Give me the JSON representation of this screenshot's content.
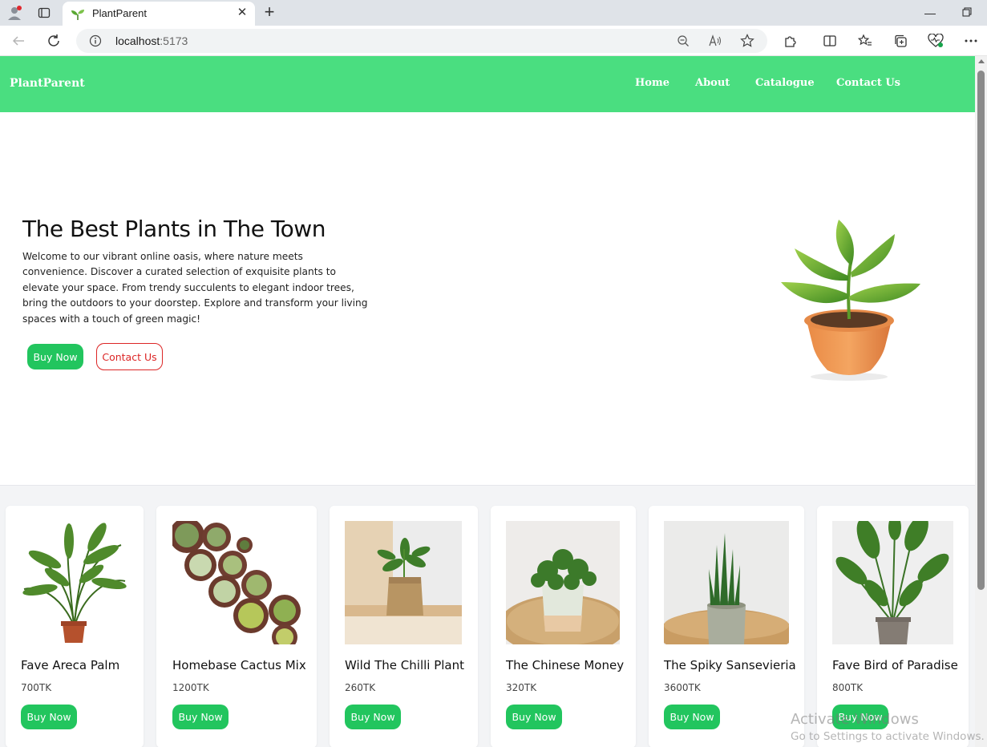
{
  "browser": {
    "tab_title": "PlantParent",
    "url_host": "localhost",
    "url_port": ":5173",
    "icons": [
      "profile-icon",
      "tab-actions-icon",
      "favicon-sprout-icon",
      "close-icon",
      "new-tab-icon",
      "minimize-icon",
      "restore-icon",
      "back-icon",
      "refresh-icon",
      "info-icon",
      "zoom-out-icon",
      "read-aloud-icon",
      "favorite-star-icon",
      "extensions-icon",
      "split-screen-icon",
      "favorites-icon",
      "collections-icon",
      "browser-essentials-icon",
      "more-icon"
    ]
  },
  "navbar": {
    "brand": "PlantParent",
    "links": [
      "Home",
      "About",
      "Catalogue",
      "Contact Us"
    ],
    "background": "#4ade80"
  },
  "hero": {
    "title": "The Best Plants in The Town",
    "text": "Welcome to our vibrant online oasis, where nature meets convenience. Discover a curated selection of exquisite plants to elevate your space. From trendy succulents to elegant indoor trees, bring the outdoors to your doorstep. Explore and transform your living spaces with a touch of green magic!",
    "buy_label": "Buy Now",
    "contact_label": "Contact Us"
  },
  "products": [
    {
      "name": "Fave Areca Palm",
      "price": "700TK",
      "button": "Buy Now"
    },
    {
      "name": "Homebase Cactus Mix",
      "price": "1200TK",
      "button": "Buy Now"
    },
    {
      "name": "Wild The Chilli Plant",
      "price": "260TK",
      "button": "Buy Now"
    },
    {
      "name": "The Chinese Money",
      "price": "320TK",
      "button": "Buy Now"
    },
    {
      "name": "The Spiky Sansevieria",
      "price": "3600TK",
      "button": "Buy Now"
    },
    {
      "name": "Fave Bird of Paradise",
      "price": "800TK",
      "button": "Buy Now"
    }
  ],
  "watermark": {
    "line1": "Activate Windows",
    "line2": "Go to Settings to activate Windows."
  },
  "colors": {
    "accent_green": "#22c55e",
    "contact_red": "#dc2626",
    "products_bg": "#f3f4f6"
  }
}
